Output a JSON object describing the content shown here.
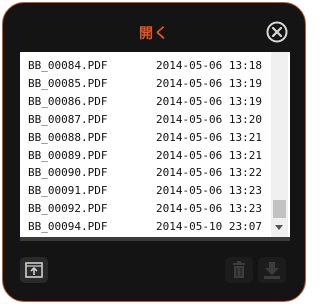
{
  "title": "開く",
  "close_icon": "close-circle-icon",
  "files": [
    {
      "name": "BB_00084.PDF",
      "date": "2014-05-06 13:18"
    },
    {
      "name": "BB_00085.PDF",
      "date": "2014-05-06 13:19"
    },
    {
      "name": "BB_00086.PDF",
      "date": "2014-05-06 13:19"
    },
    {
      "name": "BB_00087.PDF",
      "date": "2014-05-06 13:20"
    },
    {
      "name": "BB_00088.PDF",
      "date": "2014-05-06 13:21"
    },
    {
      "name": "BB_00089.PDF",
      "date": "2014-05-06 13:21"
    },
    {
      "name": "BB_00090.PDF",
      "date": "2014-05-06 13:22"
    },
    {
      "name": "BB_00091.PDF",
      "date": "2014-05-06 13:23"
    },
    {
      "name": "BB_00092.PDF",
      "date": "2014-05-06 13:23"
    },
    {
      "name": "BB_00094.PDF",
      "date": "2014-05-10 23:07"
    }
  ],
  "toolbar": {
    "up_icon": "folder-up-icon",
    "delete_icon": "trash-icon",
    "download_icon": "download-icon"
  },
  "colors": {
    "accent": "#e2562a",
    "background": "#141414",
    "list_background": "#ffffff"
  }
}
